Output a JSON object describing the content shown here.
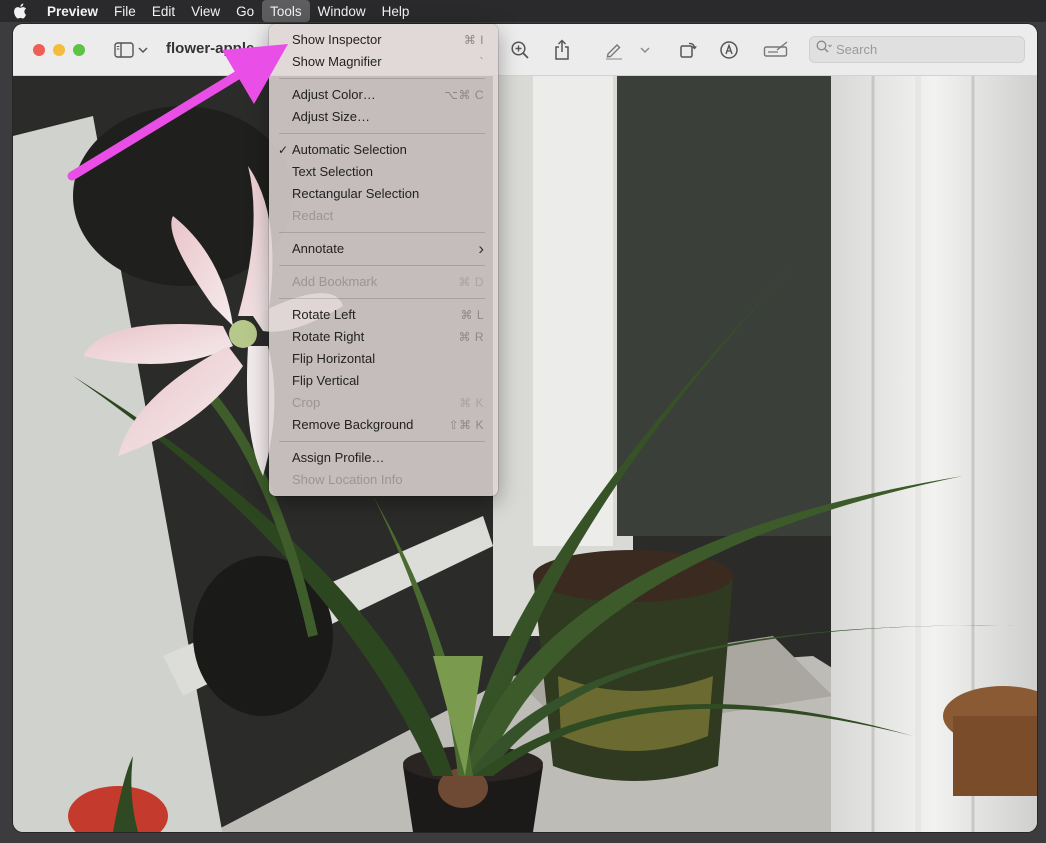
{
  "menubar": {
    "app": "Preview",
    "items": [
      "File",
      "Edit",
      "View",
      "Go",
      "Tools",
      "Window",
      "Help"
    ],
    "active": "Tools"
  },
  "window": {
    "title": "flower-apple",
    "search_placeholder": "Search"
  },
  "tools_menu": {
    "show_inspector": {
      "label": "Show Inspector",
      "shortcut": "⌘ I"
    },
    "show_magnifier": {
      "label": "Show Magnifier",
      "shortcut": "`"
    },
    "adjust_color": {
      "label": "Adjust Color…",
      "shortcut": "⌥⌘ C"
    },
    "adjust_size": {
      "label": "Adjust Size…",
      "shortcut": ""
    },
    "automatic_selection": {
      "label": "Automatic Selection",
      "checked": true,
      "check": "✓"
    },
    "text_selection": {
      "label": "Text Selection"
    },
    "rectangular_selection": {
      "label": "Rectangular Selection"
    },
    "redact": {
      "label": "Redact",
      "disabled": true
    },
    "annotate": {
      "label": "Annotate",
      "submenu": "›"
    },
    "add_bookmark": {
      "label": "Add Bookmark",
      "shortcut": "⌘ D",
      "disabled": true
    },
    "rotate_left": {
      "label": "Rotate Left",
      "shortcut": "⌘ L"
    },
    "rotate_right": {
      "label": "Rotate Right",
      "shortcut": "⌘ R"
    },
    "flip_horizontal": {
      "label": "Flip Horizontal"
    },
    "flip_vertical": {
      "label": "Flip Vertical"
    },
    "crop": {
      "label": "Crop",
      "shortcut": "⌘ K",
      "disabled": true
    },
    "remove_background": {
      "label": "Remove Background",
      "shortcut": "⇧⌘ K"
    },
    "assign_profile": {
      "label": "Assign Profile…"
    },
    "show_location_info": {
      "label": "Show Location Info",
      "disabled": true
    }
  },
  "colors": {
    "annotation_arrow": "#e94fe6",
    "menu_bg": "#ded4d4",
    "menubar_bg": "#2a2a2c"
  },
  "icons": [
    "apple-logo-icon",
    "sidebar-toggle-icon",
    "chevron-down-icon",
    "zoom-in-icon",
    "share-icon",
    "highlight-pen-icon",
    "rotate-icon",
    "markup-icon",
    "signature-icon",
    "search-icon"
  ]
}
